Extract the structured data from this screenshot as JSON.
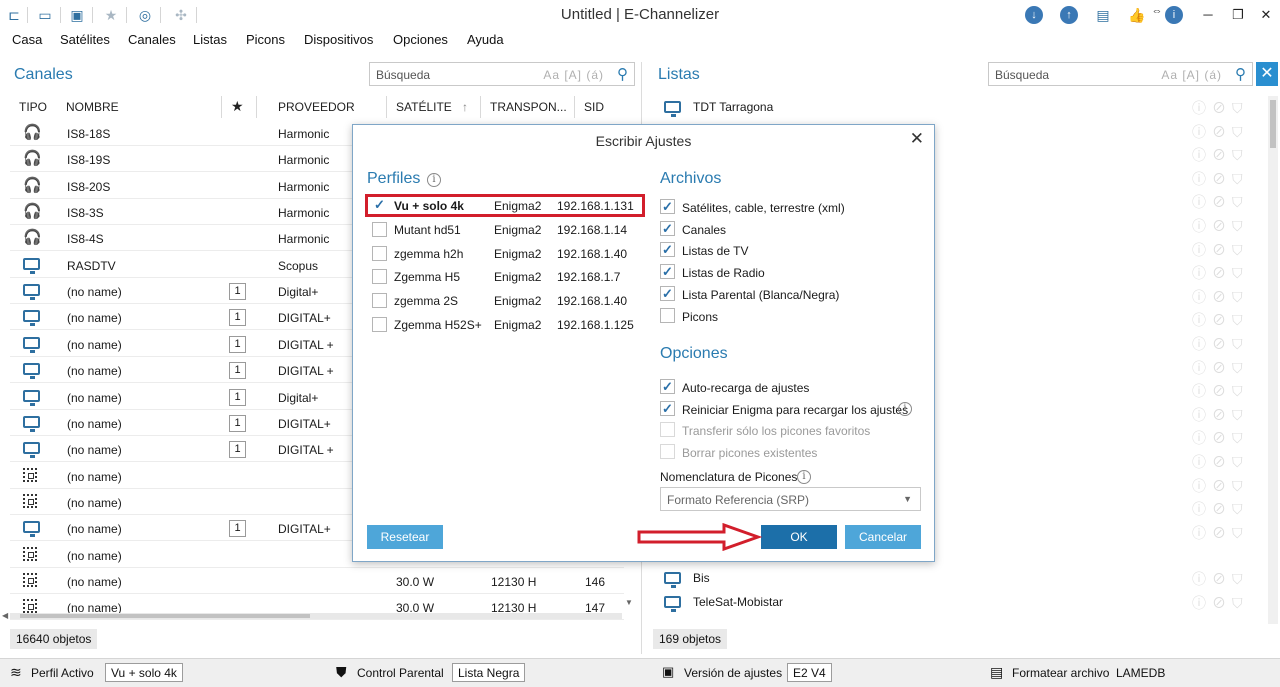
{
  "window": {
    "title": "Untitled | E-Channelizer"
  },
  "menu": [
    "Casa",
    "Satélites",
    "Canales",
    "Listas",
    "Picons",
    "Dispositivos",
    "Opciones",
    "Ayuda"
  ],
  "channels_panel": {
    "title": "Canales",
    "search_placeholder": "Búsqueda",
    "search_options": "Aa [A] (á)",
    "columns": [
      "TIPO",
      "NOMBRE",
      "★",
      "PROVEEDOR",
      "SATÉLITE",
      "TRANSPON...",
      "SID"
    ],
    "rows": [
      {
        "type": "radio",
        "name": "IS8-18S",
        "fav": "",
        "provider": "Harmonic",
        "sat": "",
        "tp": "",
        "sid": ""
      },
      {
        "type": "radio",
        "name": "IS8-19S",
        "fav": "",
        "provider": "Harmonic",
        "sat": "",
        "tp": "",
        "sid": ""
      },
      {
        "type": "radio",
        "name": "IS8-20S",
        "fav": "",
        "provider": "Harmonic",
        "sat": "",
        "tp": "",
        "sid": ""
      },
      {
        "type": "radio",
        "name": "IS8-3S",
        "fav": "",
        "provider": "Harmonic",
        "sat": "",
        "tp": "",
        "sid": ""
      },
      {
        "type": "radio",
        "name": "IS8-4S",
        "fav": "",
        "provider": "Harmonic",
        "sat": "",
        "tp": "",
        "sid": ""
      },
      {
        "type": "tv",
        "name": "RASDTV",
        "fav": "",
        "provider": "Scopus",
        "sat": "",
        "tp": "",
        "sid": ""
      },
      {
        "type": "tv",
        "name": "(no name)",
        "fav": "1",
        "provider": "Digital+",
        "sat": "",
        "tp": "",
        "sid": ""
      },
      {
        "type": "tv",
        "name": "(no name)",
        "fav": "1",
        "provider": "DIGITAL+",
        "sat": "",
        "tp": "",
        "sid": ""
      },
      {
        "type": "tv",
        "name": "(no name)",
        "fav": "1",
        "provider": "DIGITAL +",
        "sat": "",
        "tp": "",
        "sid": ""
      },
      {
        "type": "tv",
        "name": "(no name)",
        "fav": "1",
        "provider": "DIGITAL +",
        "sat": "",
        "tp": "",
        "sid": ""
      },
      {
        "type": "tv",
        "name": "(no name)",
        "fav": "1",
        "provider": "Digital+",
        "sat": "",
        "tp": "",
        "sid": ""
      },
      {
        "type": "tv",
        "name": "(no name)",
        "fav": "1",
        "provider": "DIGITAL+",
        "sat": "",
        "tp": "",
        "sid": ""
      },
      {
        "type": "tv",
        "name": "(no name)",
        "fav": "1",
        "provider": "DIGITAL +",
        "sat": "",
        "tp": "",
        "sid": ""
      },
      {
        "type": "data",
        "name": "(no name)",
        "fav": "",
        "provider": "",
        "sat": "",
        "tp": "",
        "sid": ""
      },
      {
        "type": "data",
        "name": "(no name)",
        "fav": "",
        "provider": "",
        "sat": "",
        "tp": "",
        "sid": ""
      },
      {
        "type": "tv",
        "name": "(no name)",
        "fav": "1",
        "provider": "DIGITAL+",
        "sat": "",
        "tp": "",
        "sid": ""
      },
      {
        "type": "data",
        "name": "(no name)",
        "fav": "",
        "provider": "",
        "sat": "",
        "tp": "",
        "sid": ""
      },
      {
        "type": "data",
        "name": "(no name)",
        "fav": "",
        "provider": "",
        "sat": "30.0 W",
        "tp": "12130 H",
        "sid": "146"
      },
      {
        "type": "data",
        "name": "(no name)",
        "fav": "",
        "provider": "",
        "sat": "30.0 W",
        "tp": "12130 H",
        "sid": "147"
      }
    ],
    "count": "16640 objetos"
  },
  "lists_panel": {
    "title": "Listas",
    "search_placeholder": "Búsqueda",
    "search_options": "Aa [A] (á)",
    "items": [
      {
        "name": "TDT Tarragona"
      },
      {
        "name": ""
      },
      {
        "name": ""
      },
      {
        "name": ""
      },
      {
        "name": ""
      },
      {
        "name": ""
      },
      {
        "name": ""
      },
      {
        "name": ""
      },
      {
        "name": ""
      },
      {
        "name": ""
      },
      {
        "name": ""
      },
      {
        "name": ""
      },
      {
        "name": ""
      },
      {
        "name": ""
      },
      {
        "name": ""
      },
      {
        "name": ""
      },
      {
        "name": ""
      },
      {
        "name": ""
      },
      {
        "name": ""
      },
      {
        "name": "Bis"
      },
      {
        "name": "TeleSat-Mobistar"
      }
    ],
    "count": "169 objetos"
  },
  "dialog": {
    "title": "Escribir Ajustes",
    "profiles_title": "Perfiles",
    "profiles": [
      {
        "name": "Vu + solo 4k",
        "type": "Enigma2",
        "ip": "192.168.1.131",
        "checked": true
      },
      {
        "name": "Mutant hd51",
        "type": "Enigma2",
        "ip": "192.168.1.14",
        "checked": false
      },
      {
        "name": "zgemma h2h",
        "type": "Enigma2",
        "ip": "192.168.1.40",
        "checked": false
      },
      {
        "name": "Zgemma H5",
        "type": "Enigma2",
        "ip": "192.168.1.7",
        "checked": false
      },
      {
        "name": "zgemma 2S",
        "type": "Enigma2",
        "ip": "192.168.1.40",
        "checked": false
      },
      {
        "name": "Zgemma H52S+",
        "type": "Enigma2",
        "ip": "192.168.1.125",
        "checked": false
      }
    ],
    "files_title": "Archivos",
    "files": [
      {
        "label": "Satélites, cable, terrestre (xml)",
        "checked": true
      },
      {
        "label": "Canales",
        "checked": true
      },
      {
        "label": "Listas de TV",
        "checked": true
      },
      {
        "label": "Listas de Radio",
        "checked": true
      },
      {
        "label": "Lista Parental (Blanca/Negra)",
        "checked": true
      },
      {
        "label": "Picons",
        "checked": false
      }
    ],
    "options_title": "Opciones",
    "options": [
      {
        "label": "Auto-recarga de ajustes",
        "checked": true,
        "disabled": false
      },
      {
        "label": "Reiniciar Enigma para recargar los ajustes",
        "checked": true,
        "disabled": false
      },
      {
        "label": "Transferir sólo los picones favoritos",
        "checked": false,
        "disabled": true
      },
      {
        "label": "Borrar picones existentes",
        "checked": false,
        "disabled": true
      }
    ],
    "picon_label": "Nomenclatura de Picones",
    "picon_value": "Formato Referencia (SRP)",
    "reset_label": "Resetear",
    "ok_label": "OK",
    "cancel_label": "Cancelar"
  },
  "statusbar": {
    "profile_label": "Perfil Activo",
    "profile_value": "Vu + solo 4k",
    "parental_label": "Control Parental",
    "parental_value": "Lista Negra",
    "version_label": "Versión de ajustes",
    "version_value": "E2 V4",
    "format_label": "Formatear archivo",
    "format_value": "LAMEDB"
  },
  "colors": {
    "accent": "#2a7bb0",
    "ok_button": "#1c6fa9",
    "button": "#4ea6d9",
    "highlight": "#d21e2b",
    "arrow": "#d21e2b"
  }
}
